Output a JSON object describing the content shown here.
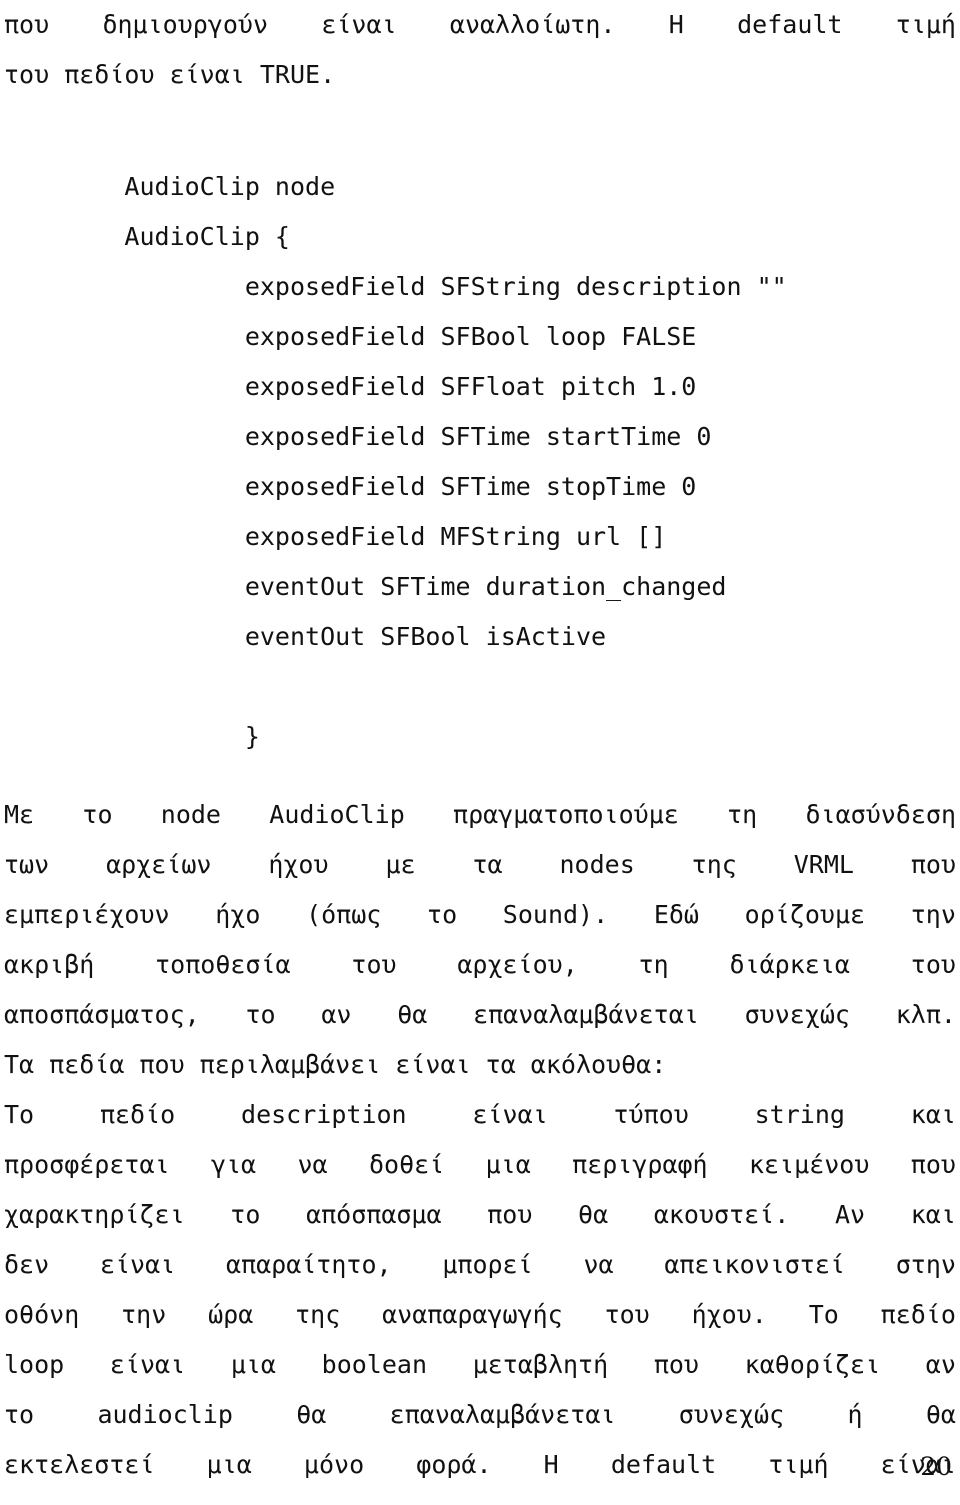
{
  "document": {
    "language": "Greek",
    "page_number": "20",
    "intro_paragraph": {
      "lines": [
        {
          "type": "justified",
          "words": [
            "που",
            "δημιουργούν",
            "είναι",
            "αναλλοίωτη.",
            "Η",
            "default",
            "τιμή"
          ]
        },
        {
          "type": "flow",
          "text": "του πεδίου είναι TRUE."
        }
      ]
    },
    "code_block": {
      "title": "AudioClip node",
      "lines": [
        "        AudioClip node",
        "        AudioClip {",
        "                exposedField SFString description \"\"",
        "                exposedField SFBool loop FALSE",
        "                exposedField SFFloat pitch 1.0",
        "                exposedField SFTime startTime 0",
        "                exposedField SFTime stopTime 0",
        "                exposedField MFString url []",
        "                eventOut SFTime duration_changed",
        "                eventOut SFBool isActive",
        "",
        "                }"
      ]
    },
    "body_paragraph_1": {
      "lines": [
        {
          "type": "justified",
          "words": [
            "Με",
            "το",
            "node",
            "AudioClip",
            "πραγματοποιούμε",
            "τη",
            "διασύνδεση"
          ]
        },
        {
          "type": "justified",
          "words": [
            "των",
            "αρχείων",
            "ήχου",
            "με",
            "τα",
            "nodes",
            "της",
            "VRML",
            "που"
          ]
        },
        {
          "type": "justified",
          "words": [
            "εμπεριέχουν",
            "ήχο",
            "(όπως",
            "το",
            "Sound).",
            "Εδώ",
            "ορίζουμε",
            "την"
          ]
        },
        {
          "type": "justified",
          "words": [
            "ακριβή",
            "τοποθεσία",
            "του",
            "αρχείου,",
            "τη",
            "διάρκεια",
            "του"
          ]
        },
        {
          "type": "justified",
          "words": [
            "αποσπάσματος,",
            "το",
            "αν",
            "θα",
            "επαναλαμβάνεται",
            "συνεχώς",
            "κλπ."
          ]
        },
        {
          "type": "flow",
          "text": "Τα πεδία που περιλαμβάνει είναι τα ακόλουθα:"
        }
      ]
    },
    "body_paragraph_2": {
      "lines": [
        {
          "type": "justified",
          "words": [
            "Το",
            "πεδίο",
            "description",
            "είναι",
            "τύπου",
            "string",
            "και"
          ]
        },
        {
          "type": "justified",
          "words": [
            "προσφέρεται",
            "για",
            "να",
            "δοθεί",
            "μια",
            "περιγραφή",
            "κειμένου",
            "που"
          ]
        },
        {
          "type": "justified",
          "words": [
            "χαρακτηρίζει",
            "το",
            "απόσπασμα",
            "που",
            "θα",
            "ακουστεί.",
            "Αν",
            "και"
          ]
        },
        {
          "type": "justified",
          "words": [
            "δεν",
            "είναι",
            "απαραίτητο,",
            "μπορεί",
            "να",
            "απεικονιστεί",
            "στην"
          ]
        },
        {
          "type": "justified",
          "words": [
            "οθόνη",
            "την",
            "ώρα",
            "της",
            "αναπαραγωγής",
            "του",
            "ήχου.",
            "Το",
            "πεδίο"
          ]
        },
        {
          "type": "justified",
          "words": [
            "loop",
            "είναι",
            "μια",
            "boolean",
            "μεταβλητή",
            "που",
            "καθορίζει",
            "αν"
          ]
        },
        {
          "type": "justified",
          "words": [
            "το",
            "audioclip",
            "θα",
            "επαναλαμβάνεται",
            "συνεχώς",
            "ή",
            "θα"
          ]
        },
        {
          "type": "justified",
          "words": [
            "εκτελεστεί",
            "μια",
            "μόνο",
            "φορά.",
            "Η",
            "default",
            "τιμή",
            "είναι"
          ]
        }
      ]
    }
  }
}
